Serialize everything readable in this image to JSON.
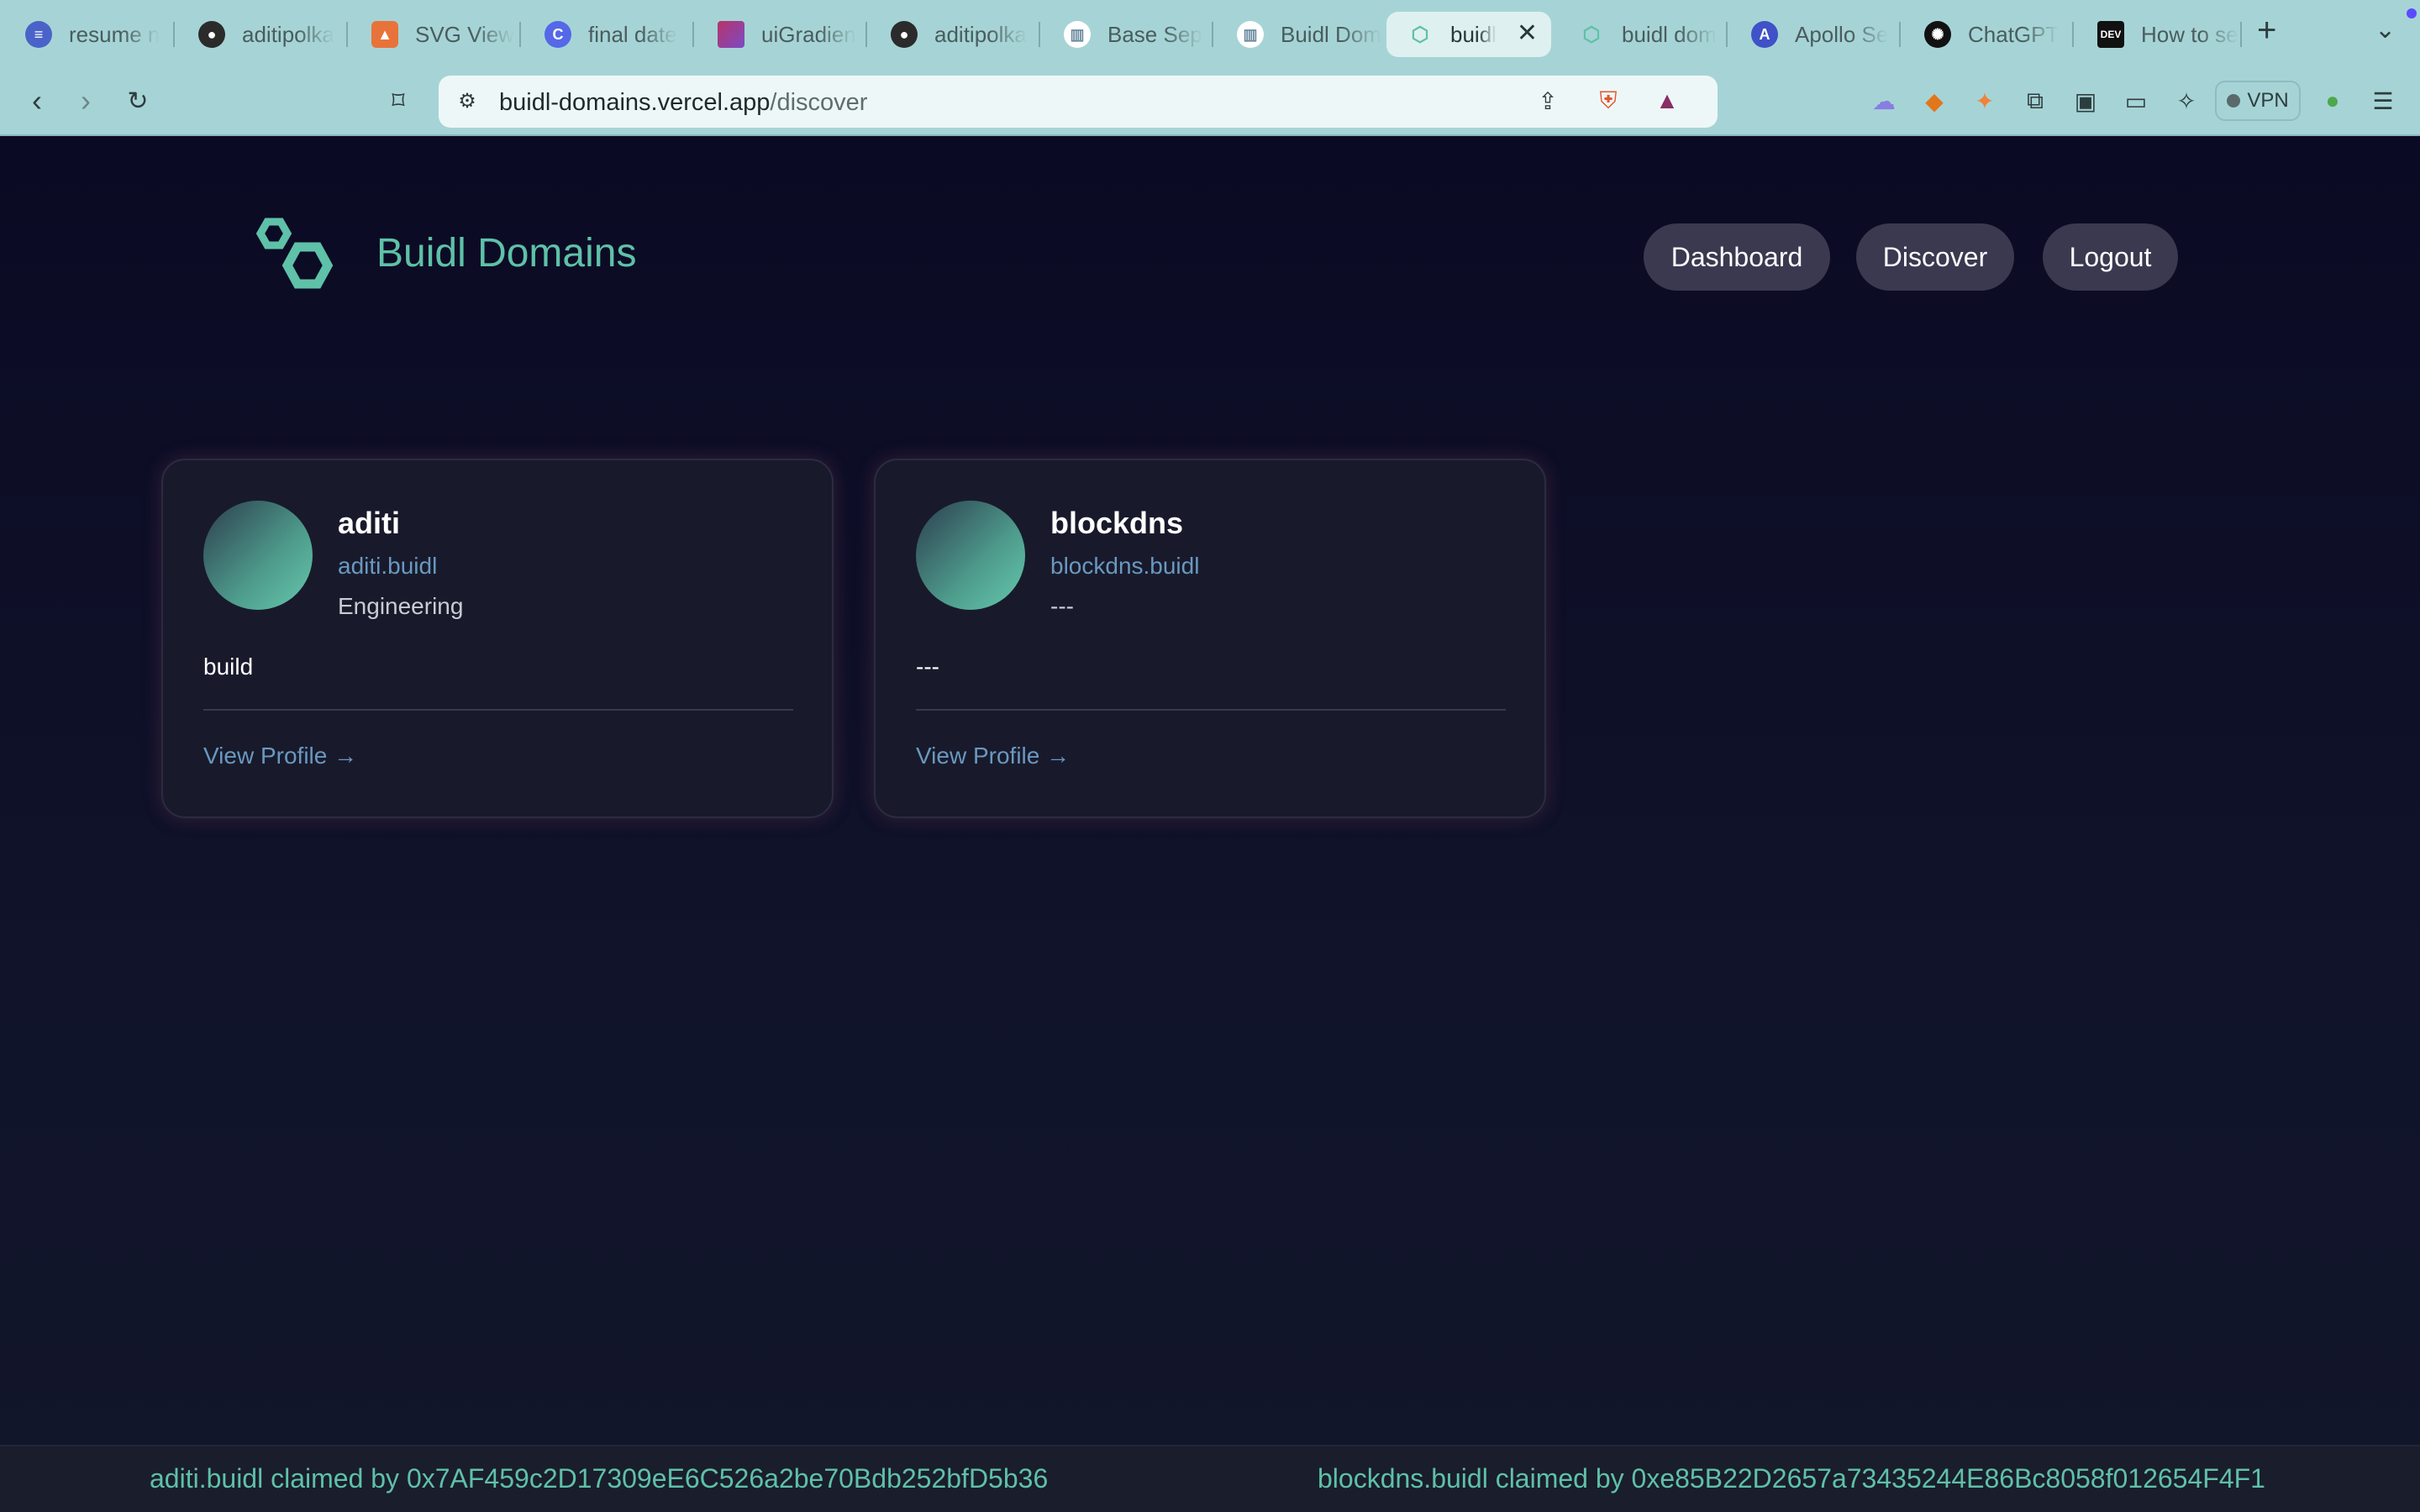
{
  "browser": {
    "tabs": [
      {
        "title": "resume n",
        "icon": "document-icon",
        "color": "#4a63c9"
      },
      {
        "title": "aditipolka",
        "icon": "github-icon",
        "color": "#2b2b2b"
      },
      {
        "title": "SVG View",
        "icon": "svg-viewer-icon",
        "color": "#e8733a"
      },
      {
        "title": "final date",
        "icon": "c-letter-icon",
        "color": "#5468e8"
      },
      {
        "title": "uiGradien",
        "icon": "gradient-icon",
        "color": "#b8336a"
      },
      {
        "title": "aditipolka",
        "icon": "github-icon",
        "color": "#2b2b2b"
      },
      {
        "title": "Base Sep",
        "icon": "chart-icon",
        "color": "#ffffff"
      },
      {
        "title": "Buidl Dom",
        "icon": "chart-icon",
        "color": "#ffffff"
      },
      {
        "title": "buidl",
        "icon": "hexagon-logo-icon",
        "color": "#5ec1a8"
      },
      {
        "title": "buidl dom",
        "icon": "hexagon-logo-icon",
        "color": "#5ec1a8"
      },
      {
        "title": "Apollo Se",
        "icon": "a-letter-icon",
        "color": "#3f52c7"
      },
      {
        "title": "ChatGPT",
        "icon": "chatgpt-icon",
        "color": "#111111"
      },
      {
        "title": "How to se",
        "icon": "dev-icon",
        "color": "#111111"
      }
    ],
    "new_tab": "+",
    "url_host": "buidl-domains.vercel.app",
    "url_path": "/discover",
    "vpn_label": "VPN"
  },
  "site": {
    "brand": "Buidl Domains",
    "nav": [
      "Dashboard",
      "Discover",
      "Logout"
    ]
  },
  "profiles": [
    {
      "name": "aditi",
      "domain": "aditi.buidl",
      "category": "Engineering",
      "bio": "build",
      "link": "View Profile →"
    },
    {
      "name": "blockdns",
      "domain": "blockdns.buidl",
      "category": "---",
      "bio": "---",
      "link": "View Profile →"
    }
  ],
  "ticker": [
    "aditi.buidl claimed by 0x7AF459c2D17309eE6C526a2be70Bdb252bfD5b36",
    "blockdns.buidl claimed by 0xe85B22D2657a73435244E86Bc8058f012654F4F1"
  ],
  "colors": {
    "accent": "#5ec1a8",
    "link": "#6a98c0",
    "pill": "#3a3950",
    "card": "#181a2b"
  }
}
